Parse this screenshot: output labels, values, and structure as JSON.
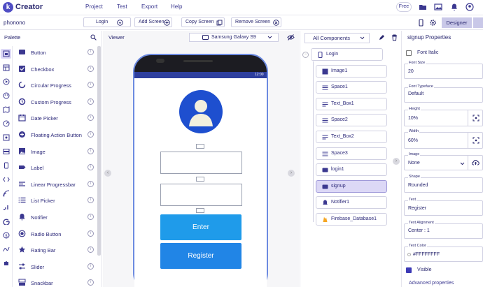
{
  "app": {
    "logo_letter": "k",
    "name": "Creator"
  },
  "menu": [
    "Project",
    "Test",
    "Export",
    "Help"
  ],
  "top_right": {
    "plan_label": "Free"
  },
  "screen_toolbar": {
    "screen_name": "phonono",
    "buttons": [
      "Login",
      "Add Screen",
      "Copy Screen",
      "Remove Screen"
    ],
    "designer_label": "Designer"
  },
  "palette": {
    "title": "Palette",
    "items": [
      {
        "label": "Button",
        "icon": "button-icon"
      },
      {
        "label": "Checkbox",
        "icon": "checkbox-icon"
      },
      {
        "label": "Circular Progress",
        "icon": "circular-progress-icon"
      },
      {
        "label": "Custom Progress",
        "icon": "custom-progress-icon"
      },
      {
        "label": "Date Picker",
        "icon": "date-picker-icon"
      },
      {
        "label": "Floating Action Button",
        "icon": "fab-icon"
      },
      {
        "label": "Image",
        "icon": "image-icon"
      },
      {
        "label": "Label",
        "icon": "label-icon"
      },
      {
        "label": "Linear Progressbar",
        "icon": "linear-progress-icon"
      },
      {
        "label": "List Picker",
        "icon": "list-picker-icon"
      },
      {
        "label": "Notifier",
        "icon": "notifier-icon"
      },
      {
        "label": "Radio Button",
        "icon": "radio-button-icon"
      },
      {
        "label": "Rating Bar",
        "icon": "rating-bar-icon"
      },
      {
        "label": "Slider",
        "icon": "slider-icon"
      },
      {
        "label": "Snackbar",
        "icon": "snackbar-icon"
      }
    ]
  },
  "viewer": {
    "title": "Viewer",
    "device": "Samsung Galaxy S9",
    "status_time": "12:00",
    "buttons": {
      "enter": "Enter",
      "register": "Register"
    },
    "colors": {
      "status": "#2e3f9e",
      "enter": "#1f9bea",
      "register": "#2185e6",
      "avatar": "#1e4fcf"
    }
  },
  "components": {
    "selector": "All Components",
    "nodes": [
      "Login",
      "Image1",
      "Space1",
      "Text_Box1",
      "Space2",
      "Text_Box2",
      "Space3",
      "login1",
      "signup",
      "Notifier1",
      "Firebase_Database1"
    ],
    "selected": "signup"
  },
  "properties": {
    "title": "signup Properties",
    "font_italic": "Font Italic",
    "font_size": {
      "label": "Font Size",
      "value": "20"
    },
    "font_typeface": {
      "label": "Font Typeface",
      "value": "Default"
    },
    "height": {
      "label": "Height",
      "value": "10%"
    },
    "width": {
      "label": "Width",
      "value": "60%"
    },
    "image": {
      "label": "Image",
      "value": "None"
    },
    "shape": {
      "label": "Shape",
      "value": "Rounded"
    },
    "text": {
      "label": "Text",
      "value": "Register"
    },
    "text_alignment": {
      "label": "Text Alignment",
      "value": "Center : 1"
    },
    "text_color": {
      "label": "Text Color",
      "value": "#FFFFFFFF"
    },
    "visible": "Visible",
    "advanced": "Advanced properties"
  }
}
